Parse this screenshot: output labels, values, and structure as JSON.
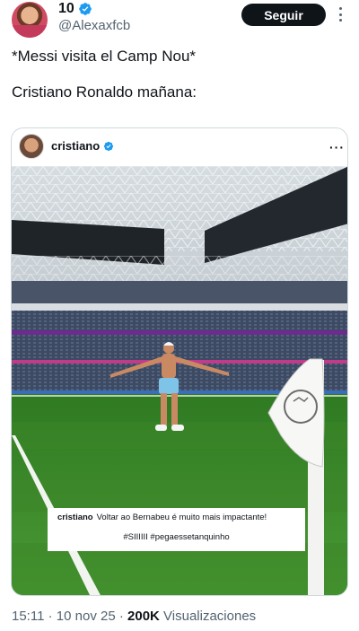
{
  "tweet": {
    "display_name": "10",
    "handle": "@Alexaxfcb",
    "follow_label": "Seguir",
    "text_line1": "*Messi visita el Camp Nou*",
    "text_line2": "Cristiano Ronaldo mañana:",
    "time": "15:11",
    "date": "10 nov 25",
    "views_count": "200K",
    "views_label": "Visualizaciones",
    "separator": "·"
  },
  "embedded_post": {
    "username": "cristiano",
    "more": "···",
    "caption_user": "cristiano",
    "caption_text": "Voltar ao Bernabeu é muito mais impactante!",
    "caption_hashtags": "#SIIIIII #pegaessetanquinho"
  },
  "colors": {
    "verified_blue": "#1d9bf0",
    "text_primary": "#0f1419",
    "text_secondary": "#536471",
    "follow_button_bg": "#0f1419",
    "pitch_green": "#3f8a2c"
  },
  "icons": {
    "verified": "verified-badge-icon",
    "more": "more-options-icon"
  }
}
